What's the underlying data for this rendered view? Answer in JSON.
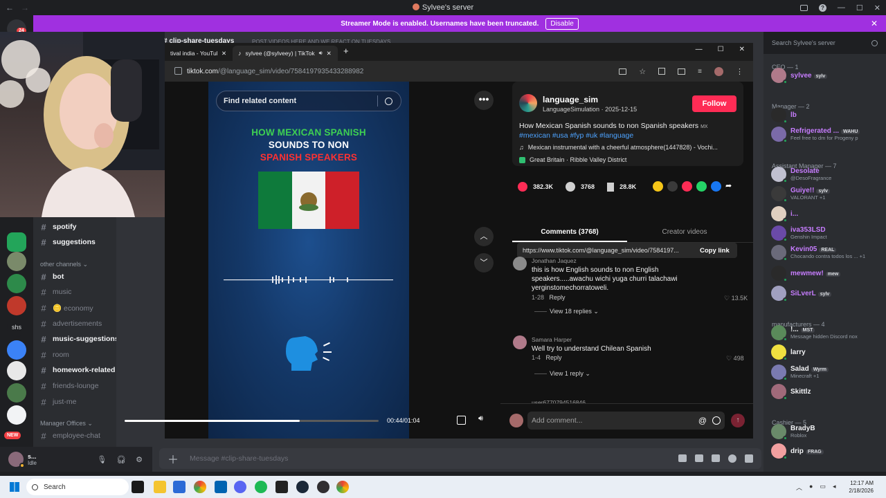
{
  "window": {
    "title": "Sylvee's server"
  },
  "banner": {
    "text": "Streamer Mode is enabled. Usernames have been truncated.",
    "disable_label": "Disable"
  },
  "servers": {
    "notif_count": "24",
    "shs_label": "shs",
    "new_label": "NEW"
  },
  "channels": {
    "items": [
      {
        "name": "spotify",
        "style": "bright"
      },
      {
        "name": "suggestions",
        "style": "bright"
      },
      {
        "name": "bot",
        "style": "bright"
      },
      {
        "name": "music",
        "style": "dim"
      },
      {
        "name": "🪙 economy",
        "style": "dim"
      },
      {
        "name": "advertisements",
        "style": "dim"
      },
      {
        "name": "music-suggestions",
        "style": "bright"
      },
      {
        "name": "room",
        "style": "dim"
      },
      {
        "name": "homework-related",
        "style": "bright"
      },
      {
        "name": "friends-lounge",
        "style": "dim"
      },
      {
        "name": "just-me",
        "style": "dim"
      },
      {
        "name": "employee-chat",
        "style": "dim"
      }
    ],
    "category_other": "other channels",
    "category_manager": "Manager Offices"
  },
  "chat": {
    "current_channel": "clip-share-tuesdays",
    "topic": "POST VIDEOS HERE AND WE REACT ON TUESDAYS",
    "placeholder": "Message #clip-share-tuesdays"
  },
  "user_panel": {
    "name": "s...",
    "status": "Idle"
  },
  "members": {
    "search_placeholder": "Search Sylvee's server",
    "groups": [
      {
        "label": "CEO — 1"
      },
      {
        "label": "Manager — 2"
      },
      {
        "label": "Assistant Manager — 7"
      },
      {
        "label": "manufacturers — 4"
      },
      {
        "label": "Cashier — 5"
      }
    ],
    "list": [
      {
        "name": "sylvee",
        "tag": "sylv",
        "sub": "",
        "color": "#c77dff"
      },
      {
        "name": "lb",
        "tag": "",
        "sub": "",
        "color": "#c77dff"
      },
      {
        "name": "Refrigerated ...",
        "tag": "WAHU",
        "sub": "Feel free to dm for Progeny p",
        "color": "#c77dff"
      },
      {
        "name": "Desolate",
        "tag": "",
        "sub": "@DesoFragrance",
        "color": "#c77dff"
      },
      {
        "name": "Guiye!!",
        "tag": "sylv",
        "sub": "VALORANT +1",
        "color": "#c77dff"
      },
      {
        "name": "i...",
        "tag": "",
        "sub": "",
        "color": "#c77dff"
      },
      {
        "name": "iva353LSD",
        "tag": "",
        "sub": "Genshin Impact",
        "color": "#c77dff"
      },
      {
        "name": "Kevin05",
        "tag": "REAL",
        "sub": "Chocando contra todos los ... +1",
        "color": "#c77dff"
      },
      {
        "name": "mewmew!",
        "tag": "mew",
        "sub": "",
        "color": "#c77dff"
      },
      {
        "name": "SiLverL",
        "tag": "sylv",
        "sub": "",
        "color": "#c77dff"
      },
      {
        "name": "!...",
        "tag": "MST",
        "sub": "Message hidden Discord nox",
        "color": "#f2f3f5"
      },
      {
        "name": "larry",
        "tag": "",
        "sub": "",
        "color": "#f2f3f5"
      },
      {
        "name": "Salad",
        "tag": "Wyrm",
        "sub": "Minecraft +1",
        "color": "#f2f3f5"
      },
      {
        "name": "Skittlz",
        "tag": "",
        "sub": "",
        "color": "#f2f3f5"
      },
      {
        "name": "BradyB",
        "tag": "",
        "sub": "Roblox",
        "color": "#f2f3f5"
      },
      {
        "name": "drip",
        "tag": "FRAG",
        "sub": "",
        "color": "#f2f3f5"
      }
    ]
  },
  "browser": {
    "tabs": [
      {
        "label": "tival india - YouTub"
      },
      {
        "label": "sylvee (@sylveey) | TikTok"
      }
    ],
    "url_host": "tiktok.com",
    "url_path": "/@language_sim/video/7584197935433288982"
  },
  "tiktok": {
    "search_placeholder": "Find related content",
    "video_text": {
      "line1": "HOW MEXICAN SPANISH",
      "line2": "SOUNDS TO NON",
      "line3": "SPANISH SPEAKERS"
    },
    "time": "00:44/01:04",
    "progress": 0.69,
    "author": {
      "handle": "language_sim",
      "display": "LanguageSimulation",
      "date": "2025-12-15"
    },
    "follow_label": "Follow",
    "caption": "How Mexican Spanish sounds to non Spanish speakers",
    "caption_flag": "MX",
    "hashtags": "#mexican #usa #fyp #uk #language",
    "music": "Mexican instrumental with a cheerful atmosphere(1447828) - Vochi...",
    "location": "Great Britain · Ribble Valley District",
    "stats": {
      "likes": "382.3K",
      "comments": "3768",
      "saves": "28.8K"
    },
    "share_url": "https://www.tiktok.com/@language_sim/video/7584197...",
    "copy_label": "Copy link",
    "tab_comments": "Comments (3768)",
    "tab_creator": "Creator videos",
    "comments": [
      {
        "user": "Jonathan Jaquez",
        "text": "this is how English sounds to non English speakers.....awachu wichi yuga churri talachawi yerginstomechorratoweli.",
        "date": "1-28",
        "reply": "Reply",
        "likes": "13.5K",
        "replies": "View 18 replies"
      },
      {
        "user": "Samara Harper",
        "text": "Well try to understand Chilean Spanish",
        "date": "1-4",
        "reply": "Reply",
        "likes": "498",
        "replies": "View 1 reply"
      }
    ],
    "partial_user": "user6770794516846",
    "add_comment": "Add comment..."
  },
  "taskbar": {
    "search_label": "Search",
    "time": "12:17 AM",
    "date": "2/18/2026"
  },
  "colors": {
    "discord_bg": "#313338",
    "banner": "#a030e0",
    "tiktok_red": "#fe2c55",
    "link_blue": "#4da3ff"
  }
}
